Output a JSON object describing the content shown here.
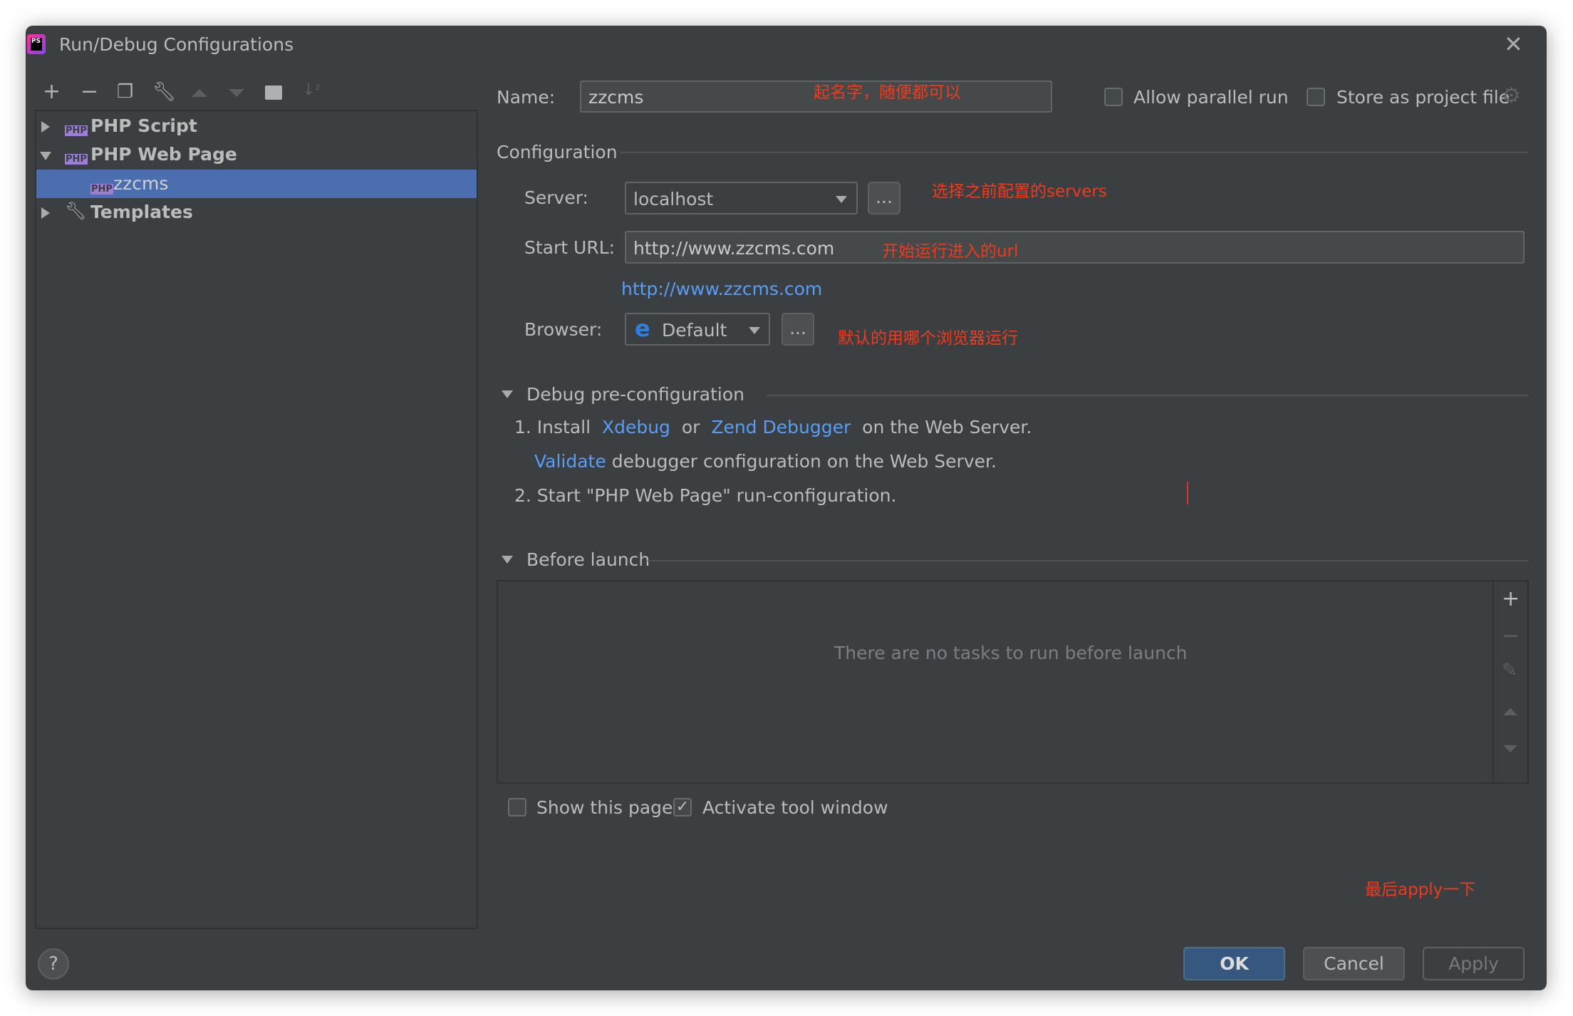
{
  "window": {
    "title": "Run/Debug Configurations",
    "app_icon": "phpstorm-icon"
  },
  "toolbar": {
    "icons": [
      "plus-icon",
      "minus-icon",
      "copy-icon",
      "wrench-icon",
      "arrow-up-icon",
      "arrow-down-icon",
      "new-folder-icon",
      "sort-alpha-icon"
    ]
  },
  "tree": {
    "items": [
      {
        "label": "PHP Script",
        "expanded": false
      },
      {
        "label": "PHP Web Page",
        "expanded": true
      },
      {
        "label": "zzcms",
        "selected": true
      },
      {
        "label": "Templates",
        "expanded": false
      }
    ],
    "php_badge": "PHP"
  },
  "name_field": {
    "label": "Name:",
    "value": "zzcms",
    "annotation": "起名字，随便都可以"
  },
  "allow_parallel": {
    "label": "Allow parallel run",
    "checked": false
  },
  "store_project": {
    "label": "Store as project file",
    "checked": false
  },
  "configuration": {
    "title": "Configuration",
    "server": {
      "label": "Server:",
      "value": "localhost",
      "more": "...",
      "annotation": "选择之前配置的servers"
    },
    "start_url": {
      "label": "Start URL:",
      "value": "http://www.zzcms.com",
      "annotation": "开始运行进入的url",
      "link": "http://www.zzcms.com"
    },
    "browser": {
      "label": "Browser:",
      "value": "Default",
      "more": "...",
      "annotation": "默认的用哪个浏览器运行"
    }
  },
  "debug": {
    "title": "Debug pre-configuration",
    "step1_prefix": "1. Install",
    "xdebug": "Xdebug",
    "or": "or",
    "zend": "Zend Debugger",
    "step1_suffix": "on the Web Server.",
    "validate": "Validate",
    "validate_suffix": "debugger configuration on the Web Server.",
    "step2": "2. Start \"PHP Web Page\" run-configuration."
  },
  "before_launch": {
    "title": "Before launch",
    "empty": "There are no tasks to run before launch"
  },
  "show_page": {
    "label": "Show this page",
    "checked": false
  },
  "activate_tool": {
    "label": "Activate tool window",
    "checked": true
  },
  "final_annotation": "最后apply一下",
  "buttons": {
    "ok": "OK",
    "cancel": "Cancel",
    "apply": "Apply",
    "help": "?"
  },
  "colors": {
    "bg": "#3c3f41",
    "selection": "#4b6eaf",
    "link": "#589df6",
    "annotation": "#f2391c",
    "ok": "#365880"
  }
}
